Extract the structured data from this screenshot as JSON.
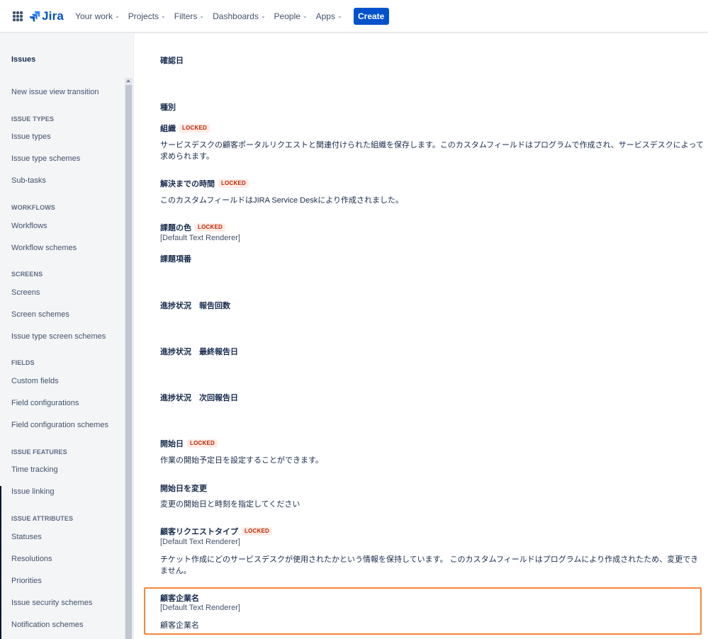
{
  "topnav": {
    "logo_text": "Jira",
    "items": [
      {
        "label": "Your work"
      },
      {
        "label": "Projects"
      },
      {
        "label": "Filters"
      },
      {
        "label": "Dashboards"
      },
      {
        "label": "People"
      },
      {
        "label": "Apps"
      }
    ],
    "chevron": "⌄",
    "create_label": "Create"
  },
  "sidebar": {
    "title": "Issues",
    "new_view": "New issue view transition",
    "issue_types_head": "ISSUE TYPES",
    "issue_types": "Issue types",
    "issue_type_schemes": "Issue type schemes",
    "sub_tasks": "Sub-tasks",
    "workflows_head": "WORKFLOWS",
    "workflows": "Workflows",
    "workflow_schemes": "Workflow schemes",
    "screens_head": "SCREENS",
    "screens": "Screens",
    "screen_schemes": "Screen schemes",
    "issue_type_screen_schemes": "Issue type screen schemes",
    "fields_head": "FIELDS",
    "custom_fields": "Custom fields",
    "field_configurations": "Field configurations",
    "field_configuration_schemes": "Field configuration schemes",
    "features_head": "ISSUE FEATURES",
    "time_tracking": "Time tracking",
    "issue_linking": "Issue linking",
    "attributes_head": "ISSUE ATTRIBUTES",
    "statuses": "Statuses",
    "resolutions": "Resolutions",
    "priorities": "Priorities",
    "issue_security_schemes": "Issue security schemes",
    "notification_schemes": "Notification schemes"
  },
  "fields": {
    "locked_label": "LOCKED",
    "f1_name": "確認日",
    "f2_name": "種別",
    "f3_name": "組織",
    "f3_desc": "サービスデスクの顧客ポータルリクエストと関連付けられた組織を保存します。このカスタムフィールドはプログラムで作成され、サービスデスクによって求められます。",
    "f4_name": "解決までの時間",
    "f4_desc": "このカスタムフィールドはJIRA Service Deskにより作成されました。",
    "f5_name": "課題の色",
    "f5_renderer": "[Default Text Renderer]",
    "f6_name": "課題項番",
    "f7_name": "進捗状況　報告回数",
    "f8_name": "進捗状況　最終報告日",
    "f9_name": "進捗状況　次回報告日",
    "f10_name": "開始日",
    "f10_desc": "作業の開始予定日を設定することができます。",
    "f11_name": "開始日を変更",
    "f11_desc": "変更の開始日と時刻を指定してください",
    "f12_name": "顧客リクエストタイプ",
    "f12_renderer": "[Default Text Renderer]",
    "f12_desc": "チケット作成にどのサービスデスクが使用されたかという情報を保持しています。 このカスタムフィールドはプログラムにより作成されたため、変更できません。",
    "f13_name": "顧客企業名",
    "f13_renderer": "[Default Text Renderer]",
    "f13_desc": "顧客企業名"
  },
  "colors": {
    "brand": "#0052cc",
    "highlight": "#f5873b",
    "locked_bg": "#ffebe6",
    "locked_text": "#bf2600"
  }
}
